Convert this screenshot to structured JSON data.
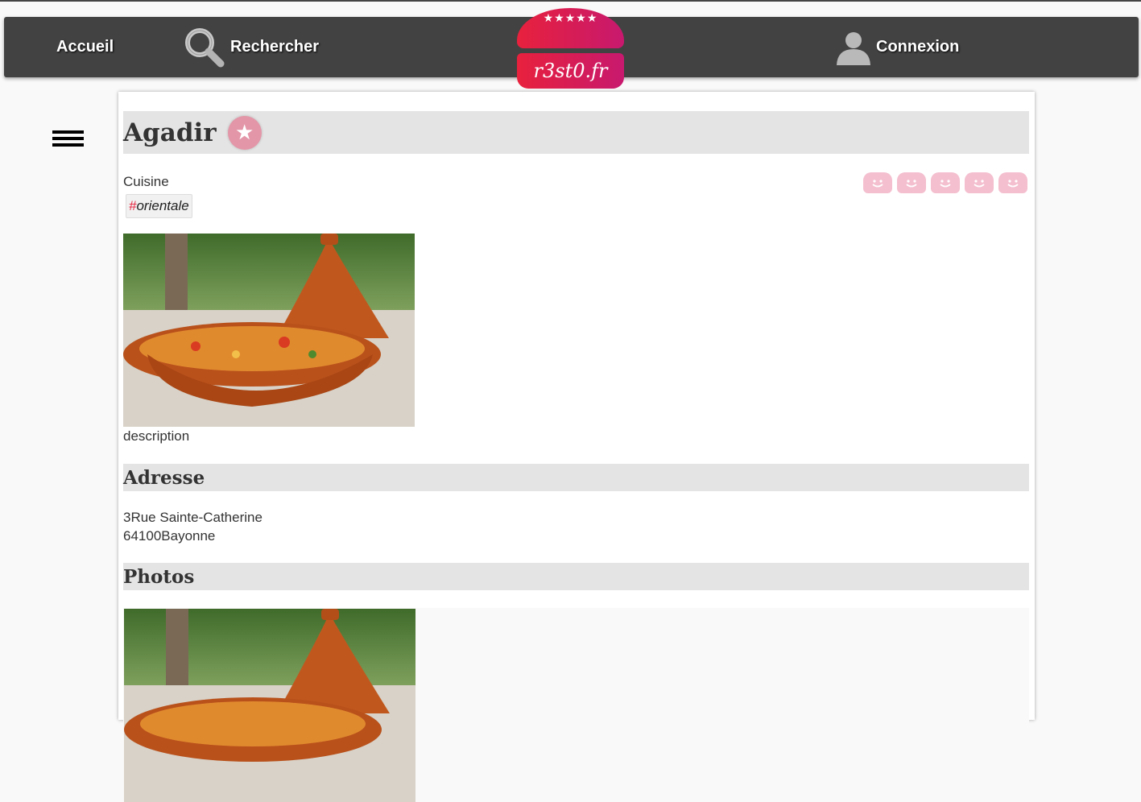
{
  "nav": {
    "home_label": "Accueil",
    "search_label": "Rechercher",
    "login_label": "Connexion",
    "search_icon": "search-icon",
    "user_icon": "user-icon"
  },
  "logo": {
    "stars": "★★★★★",
    "text": "r3st0.fr"
  },
  "colors": {
    "brand": "#e8213d",
    "navbar": "#424242",
    "section_bg": "#e4e4e4",
    "rating_inactive": "#f4bfcf"
  },
  "restaurant": {
    "name": "Agadir",
    "favorite_icon": "star-icon",
    "cuisine_label": "Cuisine",
    "tags": [
      {
        "hash": "#",
        "label": "orientale"
      }
    ],
    "rating": {
      "value": 0,
      "max": 5,
      "icon": "smiley-icon"
    },
    "description": "description",
    "address_heading": "Adresse",
    "address_line1": "3Rue Sainte-Catherine",
    "address_line2": "64100Bayonne",
    "photos_heading": "Photos"
  }
}
